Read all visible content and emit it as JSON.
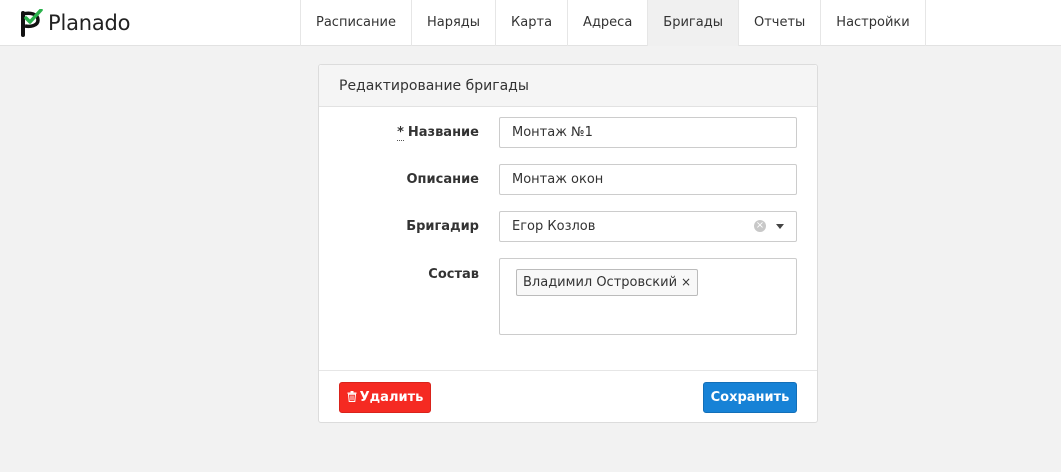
{
  "app": {
    "logo_text": "Planado"
  },
  "nav": {
    "items": [
      {
        "label": "Расписание"
      },
      {
        "label": "Наряды"
      },
      {
        "label": "Карта"
      },
      {
        "label": "Адреса"
      },
      {
        "label": "Бригады"
      },
      {
        "label": "Отчеты"
      },
      {
        "label": "Настройки"
      }
    ],
    "active": "Бригады"
  },
  "panel": {
    "title": "Редактирование бригады",
    "fields": {
      "name": {
        "required_mark": "*",
        "label": "Название",
        "value": "Монтаж №1"
      },
      "description": {
        "label": "Описание",
        "value": "Монтаж окон"
      },
      "foreman": {
        "label": "Бригадир",
        "value": "Егор Козлов"
      },
      "members": {
        "label": "Состав",
        "tags": [
          "Владимил Островский"
        ],
        "tag_remove": "×"
      }
    },
    "buttons": {
      "delete": "Удалить",
      "save": "Сохранить"
    }
  },
  "colors": {
    "delete": "#f52a22",
    "save": "#1782d6",
    "logo_check": "#2bb24c"
  },
  "icons": {
    "logo": "planado-logo-icon",
    "trash": "trash-icon",
    "clear": "clear-icon",
    "caret": "chevron-down-icon"
  }
}
